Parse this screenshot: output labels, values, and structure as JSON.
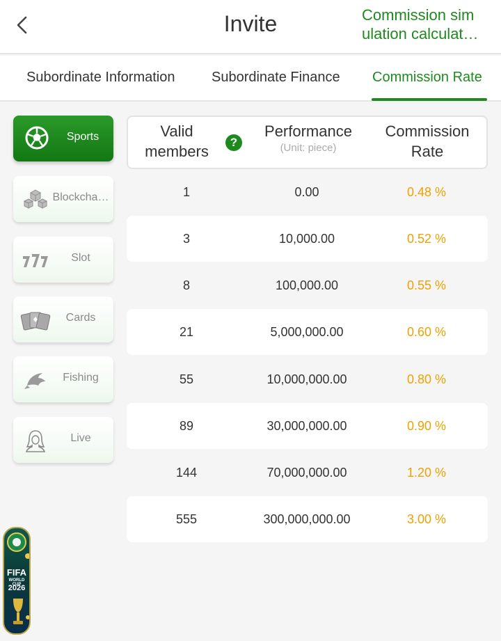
{
  "header": {
    "title": "Invite",
    "link_line1": "Commission sim",
    "link_line2": "ulation calculat…"
  },
  "tabs": [
    {
      "label": "Subordinate Information"
    },
    {
      "label": "Subordinate Finance"
    },
    {
      "label": "Commission Rate"
    }
  ],
  "sidebar": {
    "items": [
      {
        "label": "Sports",
        "icon": "soccer-ball-icon"
      },
      {
        "label": "Blockcha…",
        "icon": "blockchain-icon"
      },
      {
        "label": "Slot",
        "icon": "slot-777-icon"
      },
      {
        "label": "Cards",
        "icon": "cards-icon"
      },
      {
        "label": "Fishing",
        "icon": "fish-icon"
      },
      {
        "label": "Live",
        "icon": "live-dealer-icon"
      }
    ]
  },
  "table": {
    "col1_line1": "Valid",
    "col1_line2": "members",
    "help": "?",
    "col2": "Performance",
    "col2_sub": "(Unit: piece)",
    "col3_line1": "Commission",
    "col3_line2": "Rate",
    "rows": [
      {
        "members": "1",
        "performance": "0.00",
        "rate": "0.48 %"
      },
      {
        "members": "3",
        "performance": "10,000.00",
        "rate": "0.52 %"
      },
      {
        "members": "8",
        "performance": "100,000.00",
        "rate": "0.55 %"
      },
      {
        "members": "21",
        "performance": "5,000,000.00",
        "rate": "0.60 %"
      },
      {
        "members": "55",
        "performance": "10,000,000.00",
        "rate": "0.80 %"
      },
      {
        "members": "89",
        "performance": "30,000,000.00",
        "rate": "0.90 %"
      },
      {
        "members": "144",
        "performance": "70,000,000.00",
        "rate": "1.20 %"
      },
      {
        "members": "555",
        "performance": "300,000,000.00",
        "rate": "3.00 %"
      }
    ]
  },
  "badge": {
    "line1": "FIFA",
    "line2": "WORLD CUP",
    "line3": "2026"
  },
  "colors": {
    "accent": "#1e8a1e",
    "rate": "#f0a000",
    "background": "#f5f5f5"
  }
}
